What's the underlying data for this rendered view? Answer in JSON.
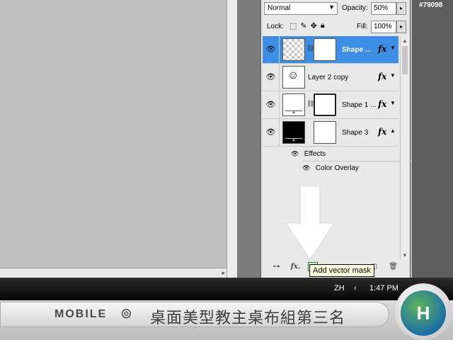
{
  "panel": {
    "blend_mode": "Normal",
    "opacity_label": "Opacity:",
    "opacity_value": "50%",
    "lock_label": "Lock:",
    "fill_label": "Fill:",
    "fill_value": "100%"
  },
  "layers": [
    {
      "name": "Shape ...",
      "selected": true
    },
    {
      "name": "Layer 2 copy",
      "selected": false
    },
    {
      "name": "Shape 1 ...",
      "selected": false
    },
    {
      "name": "Shape 3",
      "selected": false
    }
  ],
  "effects": {
    "label": "Effects",
    "items": [
      "Color Overlay"
    ]
  },
  "toolbar": {
    "fx_label": "fx.",
    "tooltip": "Add vector mask"
  },
  "watermark_id": "#79098",
  "taskbar": {
    "lang": "ZH",
    "time": "1:47 PM"
  },
  "banner": {
    "brand": "MOBILE",
    "title": "桌面美型教主桌布組第三名"
  }
}
